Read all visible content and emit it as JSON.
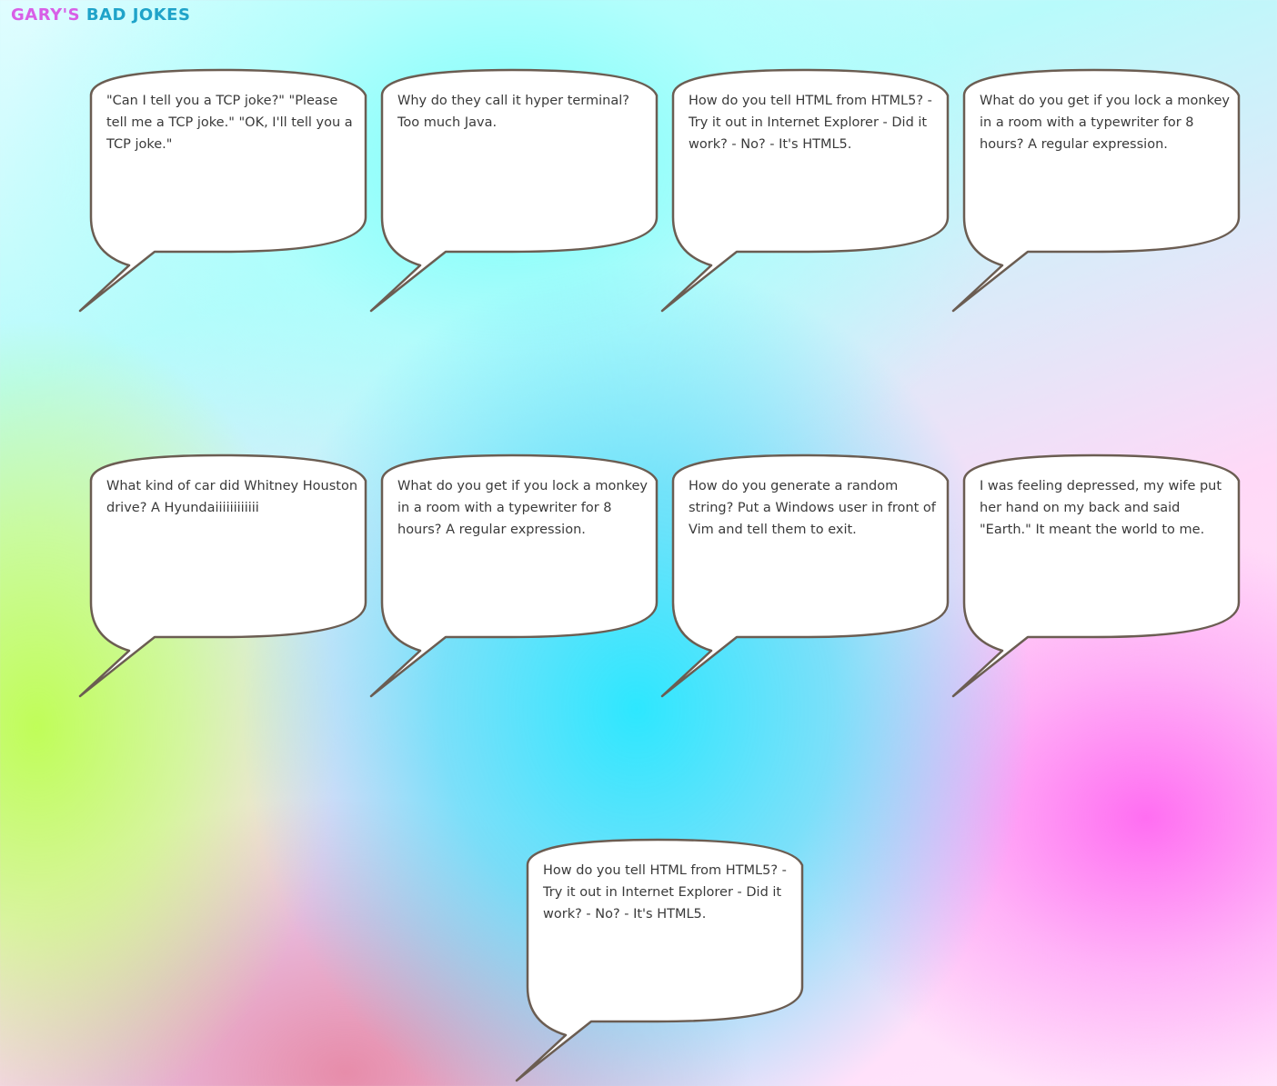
{
  "header": {
    "logo_part1": "GARY'S",
    "logo_part2": "BAD JOKES"
  },
  "jokes": [
    "\"Can I tell you a TCP joke?\" \"Please tell me a TCP joke.\" \"OK, I'll tell you a TCP joke.\"",
    "Why do they call it hyper terminal? Too much Java.",
    "How do you tell HTML from HTML5? - Try it out in Internet Explorer - Did it work? - No? - It's HTML5.",
    "What do you get if you lock a monkey in a room with a typewriter for 8 hours? A regular expression.",
    "What kind of car did Whitney Houston drive? A Hyundaiiiiiiiiiiii",
    "What do you get if you lock a monkey in a room with a typewriter for 8 hours? A regular expression.",
    "How do you generate a random string? Put a Windows user in front of Vim and tell them to exit.",
    "I was feeling depressed, my wife put her hand on my back and said \"Earth.\" It meant the world to me.",
    "How do you tell HTML from HTML5? - Try it out in Internet Explorer - Did it work? - No? - It's HTML5."
  ],
  "colors": {
    "bubble_fill": "#ffffff",
    "bubble_stroke": "#6b5d52",
    "logo_part1": "#d85fe6",
    "logo_part2": "#1fa3c9"
  }
}
